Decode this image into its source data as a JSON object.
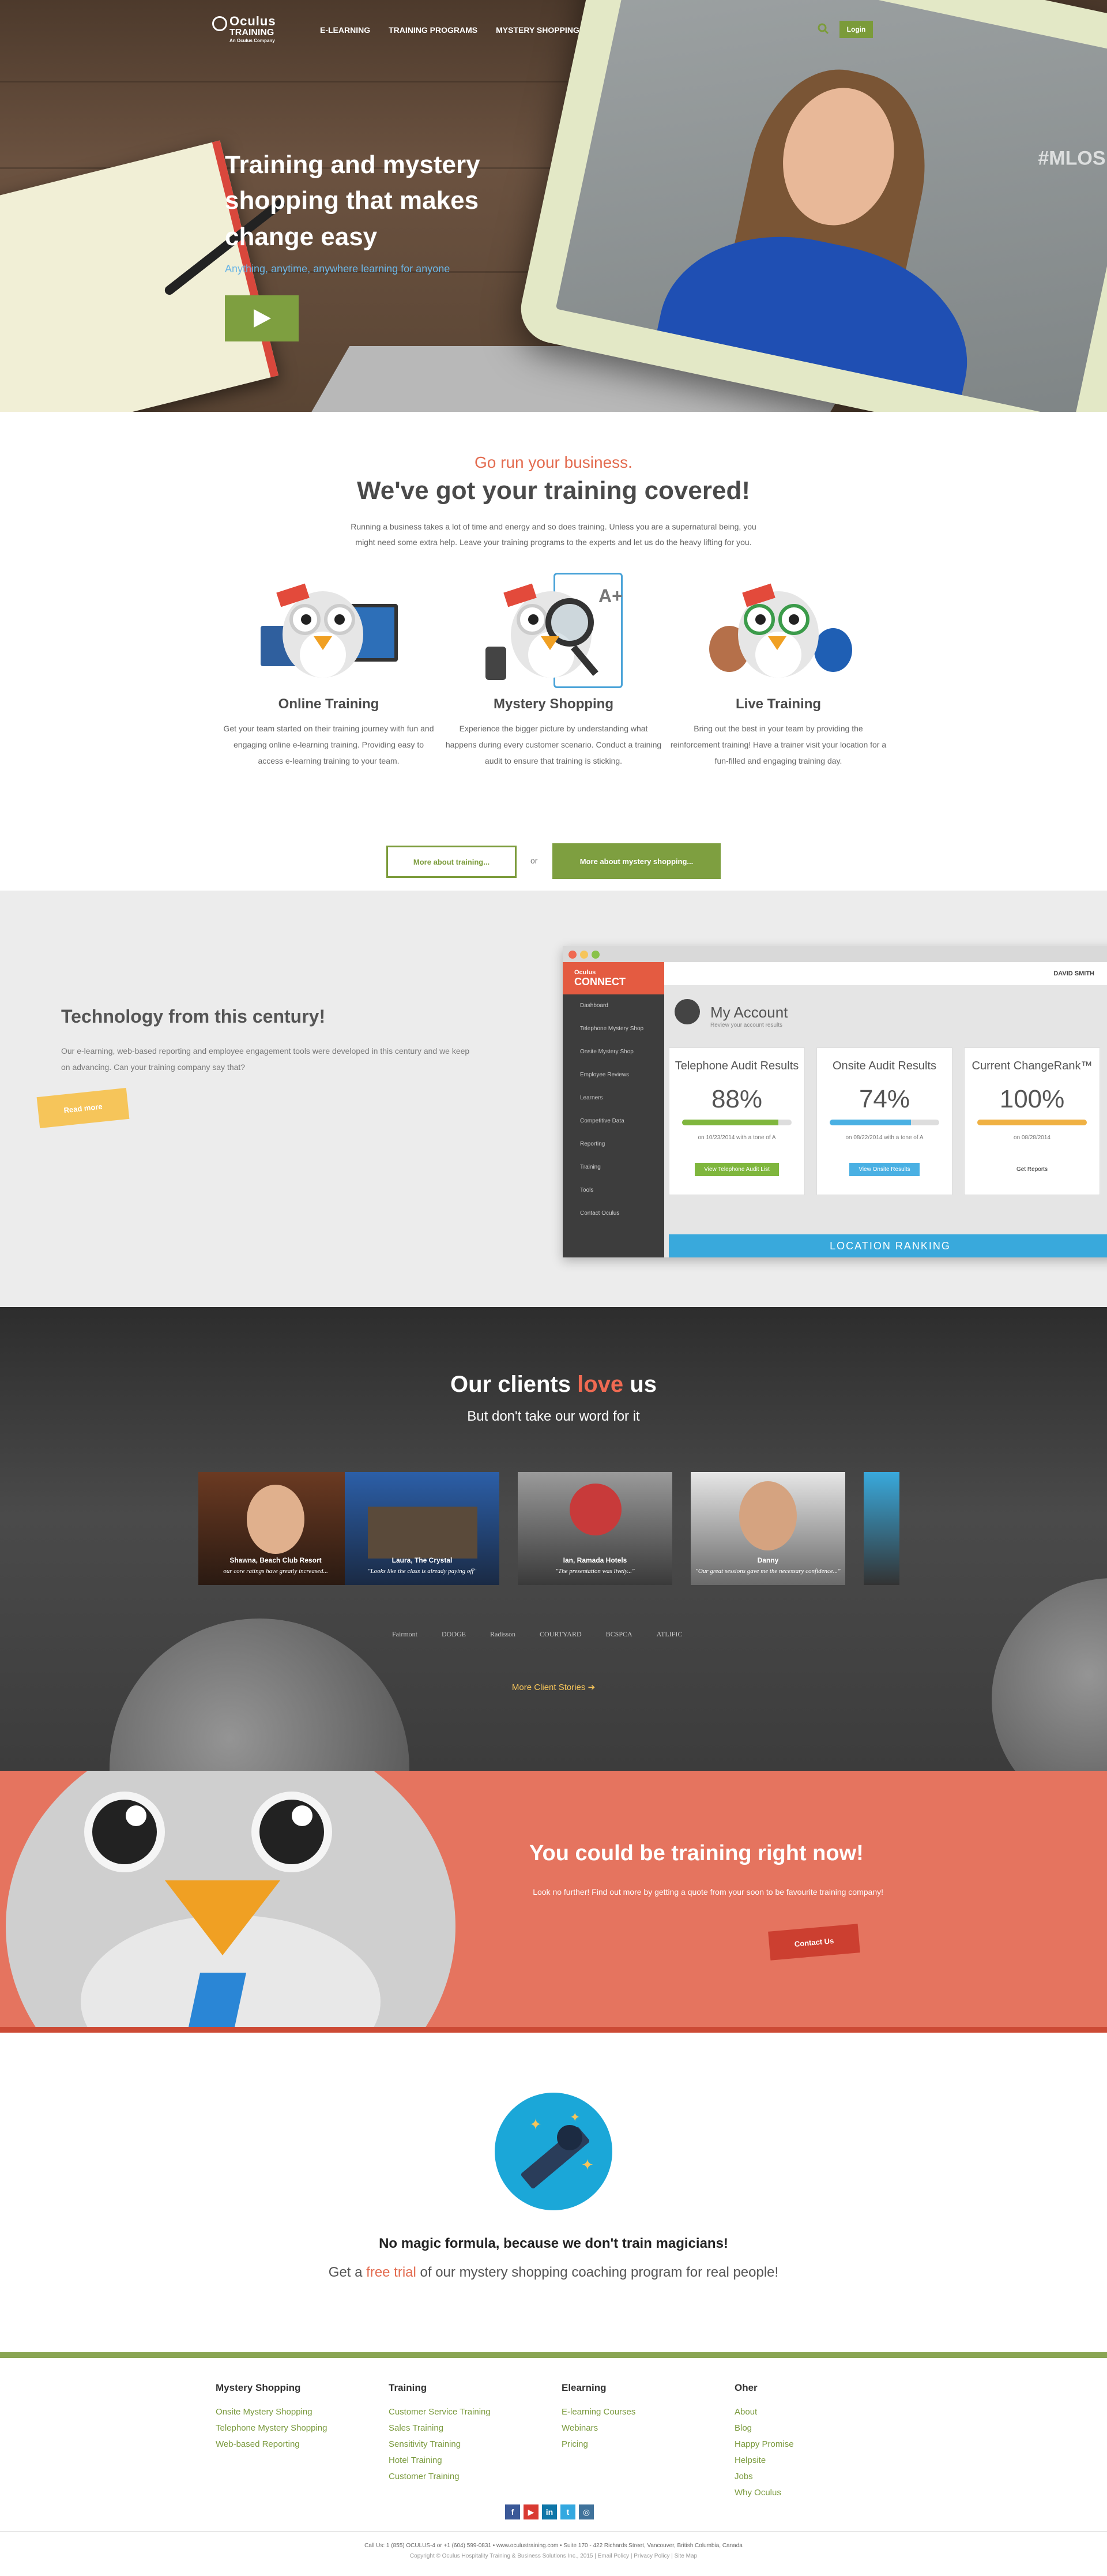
{
  "nav": {
    "logo_line1": "Oculus",
    "logo_line2": "TRAINING",
    "logo_line3": "An Oculus Company",
    "links": [
      "E-LEARNING",
      "TRAINING PROGRAMS",
      "MYSTERY SHOPPING"
    ],
    "login": "Login"
  },
  "hero": {
    "title": "Training and mystery shopping that makes change easy",
    "subtitle": "Anything, anytime, anywhere learning for anyone",
    "tablet_tag": "#MLOS"
  },
  "training": {
    "eyebrow": "Go run your business.",
    "heading": "We've got your training covered!",
    "intro": "Running a business takes a lot of time and energy and so does training. Unless you are a supernatural being, you might need some extra help. Leave your training programs to the experts and let us do the heavy lifting for you.",
    "services": [
      {
        "title": "Online Training",
        "desc": "Get your team started on their training journey with fun and engaging online e-learning training. Providing easy to access e-learning training to your team."
      },
      {
        "title": "Mystery Shopping",
        "desc": "Experience the bigger picture by understanding what happens during every customer scenario. Conduct a training audit to ensure that training is sticking."
      },
      {
        "title": "Live Training",
        "desc": "Bring out the best in your team by providing the reinforcement training! Have a trainer visit your location for a fun-filled and engaging training day."
      }
    ],
    "btn_more_training": "More about training...",
    "or": "or",
    "btn_more_mystery": "More about mystery shopping..."
  },
  "technology": {
    "title": "Technology from this century!",
    "desc": "Our e-learning, web-based reporting and employee engagement tools were developed in this century and we keep on advancing. Can your training company say that?",
    "read_more": "Read more",
    "app": {
      "logo_top": "Oculus",
      "logo_bottom": "CONNECT",
      "menu": [
        "Dashboard",
        "Telephone Mystery Shop",
        "Onsite Mystery Shop",
        "Employee Reviews",
        "Learners",
        "Competitive Data",
        "Reporting",
        "Training",
        "Tools",
        "Contact Oculus"
      ],
      "user": "DAVID SMITH",
      "account_title": "My Account",
      "account_sub": "Review your account results",
      "cards": [
        {
          "title": "Telephone Audit Results",
          "value": "88%",
          "progress": 88,
          "color": "#7fb63d",
          "date": "on 10/23/2014 with a tone of A",
          "button": "View Telephone Audit List",
          "btn_color": "#7fb63d"
        },
        {
          "title": "Onsite Audit Results",
          "value": "74%",
          "progress": 74,
          "color": "#4ab0e3",
          "date": "on 08/22/2014 with a tone of A",
          "button": "View Onsite Results",
          "btn_color": "#4ab0e3"
        },
        {
          "title": "Current ChangeRank™",
          "value": "100%",
          "progress": 100,
          "color": "#f0b143",
          "date": "on 08/28/2014",
          "button": "Get Reports",
          "btn_color": "#ffffff"
        }
      ],
      "location_bar": "LOCATION RANKING"
    }
  },
  "clients": {
    "title_pre": "Our clients ",
    "title_love": "love",
    "title_post": " us",
    "subtitle": "But don't take our word for it",
    "testimonials": [
      {
        "name": "Shawna, Beach Club Resort",
        "quote": "our core ratings have greatly increased..."
      },
      {
        "name": "Laura, The Crystal",
        "quote": "\"Looks like the class is already paying off\""
      },
      {
        "name": "Ian, Ramada Hotels",
        "quote": "\"The presentation was lively...\""
      },
      {
        "name": "Danny",
        "quote": "\"Our great sessions gave me the necessary confidence...\""
      }
    ],
    "logos": [
      "Fairmont",
      "DODGE",
      "Radisson",
      "COURTYARD",
      "BCSPCA",
      "ATLIFIC"
    ],
    "more": "More Client Stories ➔"
  },
  "cta": {
    "title": "You could be training right now!",
    "desc": "Look no further! Find out more by getting a quote from your soon to be favourite training company!",
    "button": "Contact Us"
  },
  "magic": {
    "heading": "No magic formula, because we don't train magicians!",
    "pre": "Get a ",
    "free": "free trial",
    "post": " of our mystery shopping coaching program for real people!"
  },
  "footer": {
    "columns": [
      {
        "title": "Mystery Shopping",
        "links": [
          "Onsite Mystery Shopping",
          "Telephone Mystery Shopping",
          "Web-based Reporting"
        ]
      },
      {
        "title": "Training",
        "links": [
          "Customer Service Training",
          "Sales Training",
          "Sensitivity Training",
          "Hotel Training",
          "Customer Training"
        ]
      },
      {
        "title": "Elearning",
        "links": [
          "E-learning Courses",
          "Webinars",
          "Pricing"
        ]
      },
      {
        "title": "Oher",
        "links": [
          "About",
          "Blog",
          "Happy Promise",
          "Helpsite",
          "Jobs",
          "Why Oculus"
        ]
      }
    ],
    "contact": "Call Us: 1 (855) OCULUS-4 or +1 (604) 599-0831 • www.oculustraining.com • Suite 170 - 422 Richards Street, Vancouver, British Columbia, Canada",
    "copyright": "Copyright © Oculus Hospitality Training & Business Solutions Inc., 2015 | Email Policy | Privacy Policy | Site Map"
  }
}
